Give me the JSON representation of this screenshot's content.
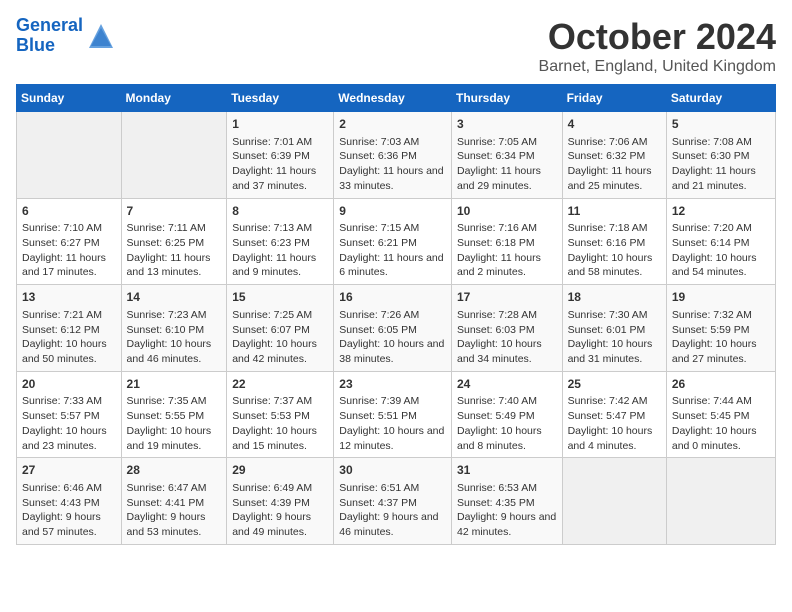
{
  "header": {
    "logo_line1": "General",
    "logo_line2": "Blue",
    "month": "October 2024",
    "location": "Barnet, England, United Kingdom"
  },
  "weekdays": [
    "Sunday",
    "Monday",
    "Tuesday",
    "Wednesday",
    "Thursday",
    "Friday",
    "Saturday"
  ],
  "weeks": [
    [
      {
        "day": "",
        "content": ""
      },
      {
        "day": "",
        "content": ""
      },
      {
        "day": "1",
        "content": "Sunrise: 7:01 AM\nSunset: 6:39 PM\nDaylight: 11 hours and 37 minutes."
      },
      {
        "day": "2",
        "content": "Sunrise: 7:03 AM\nSunset: 6:36 PM\nDaylight: 11 hours and 33 minutes."
      },
      {
        "day": "3",
        "content": "Sunrise: 7:05 AM\nSunset: 6:34 PM\nDaylight: 11 hours and 29 minutes."
      },
      {
        "day": "4",
        "content": "Sunrise: 7:06 AM\nSunset: 6:32 PM\nDaylight: 11 hours and 25 minutes."
      },
      {
        "day": "5",
        "content": "Sunrise: 7:08 AM\nSunset: 6:30 PM\nDaylight: 11 hours and 21 minutes."
      }
    ],
    [
      {
        "day": "6",
        "content": "Sunrise: 7:10 AM\nSunset: 6:27 PM\nDaylight: 11 hours and 17 minutes."
      },
      {
        "day": "7",
        "content": "Sunrise: 7:11 AM\nSunset: 6:25 PM\nDaylight: 11 hours and 13 minutes."
      },
      {
        "day": "8",
        "content": "Sunrise: 7:13 AM\nSunset: 6:23 PM\nDaylight: 11 hours and 9 minutes."
      },
      {
        "day": "9",
        "content": "Sunrise: 7:15 AM\nSunset: 6:21 PM\nDaylight: 11 hours and 6 minutes."
      },
      {
        "day": "10",
        "content": "Sunrise: 7:16 AM\nSunset: 6:18 PM\nDaylight: 11 hours and 2 minutes."
      },
      {
        "day": "11",
        "content": "Sunrise: 7:18 AM\nSunset: 6:16 PM\nDaylight: 10 hours and 58 minutes."
      },
      {
        "day": "12",
        "content": "Sunrise: 7:20 AM\nSunset: 6:14 PM\nDaylight: 10 hours and 54 minutes."
      }
    ],
    [
      {
        "day": "13",
        "content": "Sunrise: 7:21 AM\nSunset: 6:12 PM\nDaylight: 10 hours and 50 minutes."
      },
      {
        "day": "14",
        "content": "Sunrise: 7:23 AM\nSunset: 6:10 PM\nDaylight: 10 hours and 46 minutes."
      },
      {
        "day": "15",
        "content": "Sunrise: 7:25 AM\nSunset: 6:07 PM\nDaylight: 10 hours and 42 minutes."
      },
      {
        "day": "16",
        "content": "Sunrise: 7:26 AM\nSunset: 6:05 PM\nDaylight: 10 hours and 38 minutes."
      },
      {
        "day": "17",
        "content": "Sunrise: 7:28 AM\nSunset: 6:03 PM\nDaylight: 10 hours and 34 minutes."
      },
      {
        "day": "18",
        "content": "Sunrise: 7:30 AM\nSunset: 6:01 PM\nDaylight: 10 hours and 31 minutes."
      },
      {
        "day": "19",
        "content": "Sunrise: 7:32 AM\nSunset: 5:59 PM\nDaylight: 10 hours and 27 minutes."
      }
    ],
    [
      {
        "day": "20",
        "content": "Sunrise: 7:33 AM\nSunset: 5:57 PM\nDaylight: 10 hours and 23 minutes."
      },
      {
        "day": "21",
        "content": "Sunrise: 7:35 AM\nSunset: 5:55 PM\nDaylight: 10 hours and 19 minutes."
      },
      {
        "day": "22",
        "content": "Sunrise: 7:37 AM\nSunset: 5:53 PM\nDaylight: 10 hours and 15 minutes."
      },
      {
        "day": "23",
        "content": "Sunrise: 7:39 AM\nSunset: 5:51 PM\nDaylight: 10 hours and 12 minutes."
      },
      {
        "day": "24",
        "content": "Sunrise: 7:40 AM\nSunset: 5:49 PM\nDaylight: 10 hours and 8 minutes."
      },
      {
        "day": "25",
        "content": "Sunrise: 7:42 AM\nSunset: 5:47 PM\nDaylight: 10 hours and 4 minutes."
      },
      {
        "day": "26",
        "content": "Sunrise: 7:44 AM\nSunset: 5:45 PM\nDaylight: 10 hours and 0 minutes."
      }
    ],
    [
      {
        "day": "27",
        "content": "Sunrise: 6:46 AM\nSunset: 4:43 PM\nDaylight: 9 hours and 57 minutes."
      },
      {
        "day": "28",
        "content": "Sunrise: 6:47 AM\nSunset: 4:41 PM\nDaylight: 9 hours and 53 minutes."
      },
      {
        "day": "29",
        "content": "Sunrise: 6:49 AM\nSunset: 4:39 PM\nDaylight: 9 hours and 49 minutes."
      },
      {
        "day": "30",
        "content": "Sunrise: 6:51 AM\nSunset: 4:37 PM\nDaylight: 9 hours and 46 minutes."
      },
      {
        "day": "31",
        "content": "Sunrise: 6:53 AM\nSunset: 4:35 PM\nDaylight: 9 hours and 42 minutes."
      },
      {
        "day": "",
        "content": ""
      },
      {
        "day": "",
        "content": ""
      }
    ]
  ]
}
